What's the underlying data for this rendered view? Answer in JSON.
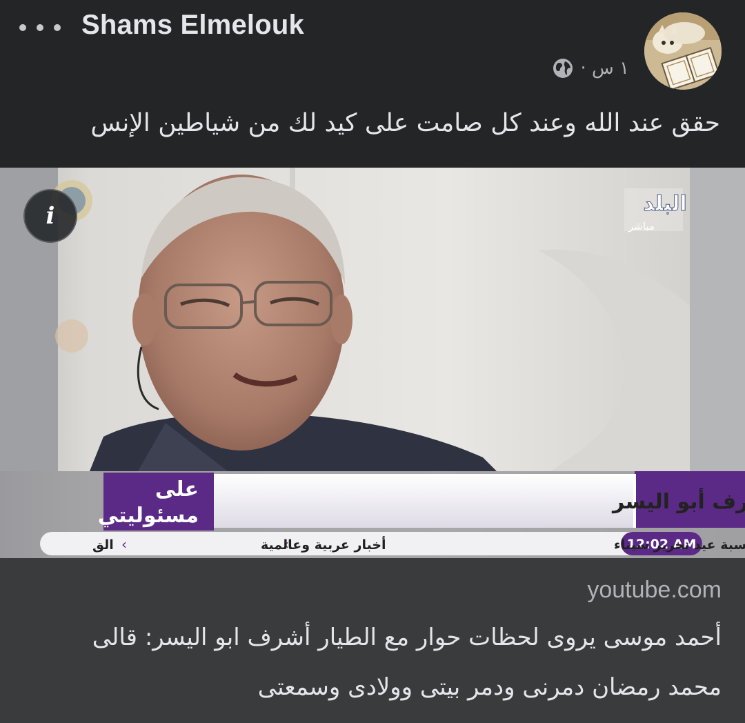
{
  "post": {
    "author": "Shams Elmelouk",
    "timestamp": "١ س ·",
    "privacy_icon": "globe-icon",
    "text": "حقق عند الله وعند كل صامت على كيد لك من شياطين الإنس"
  },
  "media": {
    "info_icon": "i",
    "channel_logo": "البلد",
    "channel_sub": "مباشر",
    "headline": "آخر ظهور للطيار الراحل أشرف أبو اليسر",
    "program_line1": "على",
    "program_line2": "مسئوليتي",
    "clock": "12:02 AM",
    "ticker": [
      "أجازة بأجر للقطاع الخاص بمناسبة عيد تحرير سيناء",
      "أخبار عربية وعالمية",
      "الق"
    ]
  },
  "link": {
    "domain": "youtube.com",
    "title": "أحمد موسى يروى لحظات حوار مع الطيار أشرف ابو اليسر: قالى محمد رمضان دمرنى ودمر بيتى وولادى وسمعتى"
  },
  "colors": {
    "background": "#242526",
    "link_card": "#3a3b3c",
    "text_primary": "#e4e6eb",
    "text_secondary": "#b0b3b8",
    "ticker_purple": "#5b2a86"
  }
}
